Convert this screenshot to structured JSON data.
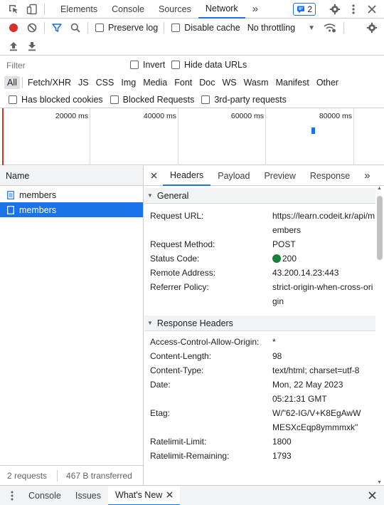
{
  "devtools": {
    "tabs": [
      "Elements",
      "Console",
      "Sources",
      "Network"
    ],
    "active_tab": "Network",
    "more_tabs": "»",
    "issues_badge": "2"
  },
  "toolbar": {
    "preserve_log": "Preserve log",
    "disable_cache": "Disable cache",
    "throttling": "No throttling"
  },
  "filter": {
    "placeholder": "Filter",
    "invert": "Invert",
    "hide_data_urls": "Hide data URLs",
    "types": [
      "All",
      "Fetch/XHR",
      "JS",
      "CSS",
      "Img",
      "Media",
      "Font",
      "Doc",
      "WS",
      "Wasm",
      "Manifest",
      "Other"
    ],
    "has_blocked_cookies": "Has blocked cookies",
    "blocked_requests": "Blocked Requests",
    "third_party": "3rd-party requests"
  },
  "overview": {
    "ticks": [
      "20000 ms",
      "40000 ms",
      "60000 ms",
      "80000 ms"
    ]
  },
  "requests": {
    "header": "Name",
    "items": [
      {
        "name": "members",
        "selected": false
      },
      {
        "name": "members",
        "selected": true
      }
    ],
    "summary_count": "2 requests",
    "summary_transferred": "467 B transferred"
  },
  "details": {
    "tabs": [
      "Headers",
      "Payload",
      "Preview",
      "Response"
    ],
    "active": "Headers",
    "more": "»",
    "general_title": "General",
    "general": [
      {
        "k": "Request URL:",
        "v": "https://learn.codeit.kr/api/members"
      },
      {
        "k": "Request Method:",
        "v": "POST"
      },
      {
        "k": "Status Code:",
        "v": "200",
        "status_color": "#188038"
      },
      {
        "k": "Remote Address:",
        "v": "43.200.14.23:443"
      },
      {
        "k": "Referrer Policy:",
        "v": "strict-origin-when-cross-origin"
      }
    ],
    "response_title": "Response Headers",
    "response": [
      {
        "k": "Access-Control-Allow-Origin:",
        "v": "*"
      },
      {
        "k": "Content-Length:",
        "v": "98"
      },
      {
        "k": "Content-Type:",
        "v": "text/html; charset=utf-8"
      },
      {
        "k": "Date:",
        "v": "Mon, 22 May 2023 05:21:31 GMT"
      },
      {
        "k": "Etag:",
        "v": "W/\"62-IG/V+K8EgAwWMESXcEqp8ymmmxk\""
      },
      {
        "k": "Ratelimit-Limit:",
        "v": "1800"
      },
      {
        "k": "Ratelimit-Remaining:",
        "v": "1793"
      }
    ]
  },
  "drawer": {
    "tabs": [
      "Console",
      "Issues",
      "What's New"
    ],
    "active": "What's New"
  }
}
